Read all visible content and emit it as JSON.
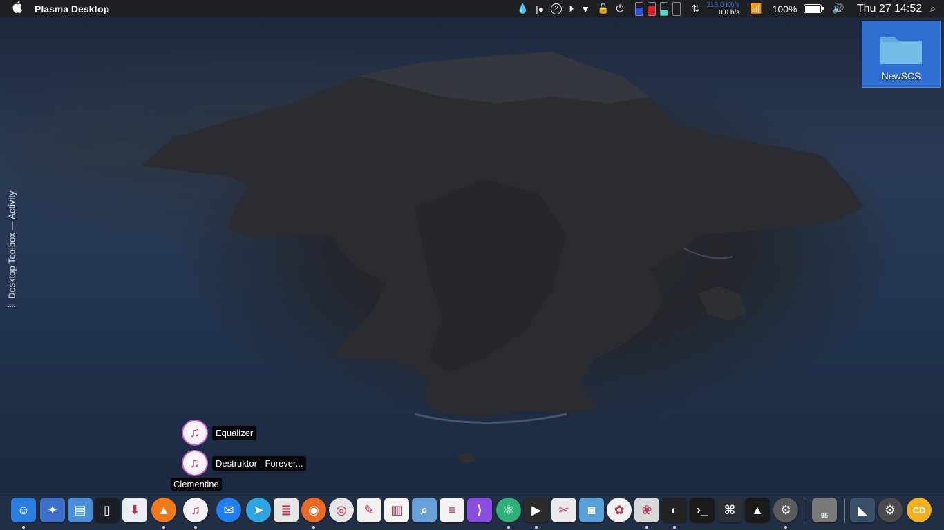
{
  "menubar": {
    "app_title": "Plasma Desktop",
    "tray": {
      "badge_number": "2",
      "net_up": "213.0 Kb/s",
      "net_down": "0.0 b/s",
      "battery_percent": "100%",
      "clock": "Thu 27  14:52"
    }
  },
  "desktop": {
    "folder_label": "NewSCS",
    "toolbox_label": "Desktop Toolbox — Activity"
  },
  "popup": {
    "entries": [
      {
        "label": "Equalizer"
      },
      {
        "label": "Destruktor - Forever..."
      }
    ],
    "tooltip": "Clementine"
  },
  "dock": {
    "icons": [
      {
        "name": "finder-icon",
        "color": "#2a7de1",
        "glyph": "☺"
      },
      {
        "name": "kde-icon",
        "color": "#3c6fc8",
        "glyph": "✦"
      },
      {
        "name": "files-icon",
        "color": "#4a8fd8",
        "glyph": "▤"
      },
      {
        "name": "kdeconnect-icon",
        "color": "#1b1e24",
        "glyph": "▯"
      },
      {
        "name": "qbittorrent-icon",
        "color": "#e8eef4",
        "glyph": "⬇"
      },
      {
        "name": "vlc-icon",
        "color": "#f07a1a",
        "glyph": "▲"
      },
      {
        "name": "clementine-icon",
        "color": "#f5f0f6",
        "glyph": "♫"
      },
      {
        "name": "messenger-icon",
        "color": "#1f7ff0",
        "glyph": "✉"
      },
      {
        "name": "telegram-icon",
        "color": "#2ca5e0",
        "glyph": "➤"
      },
      {
        "name": "news-icon",
        "color": "#e6e6e6",
        "glyph": "≣"
      },
      {
        "name": "firefox-icon",
        "color": "#e86a23",
        "glyph": "◉"
      },
      {
        "name": "chrome-icon",
        "color": "#e6e6e6",
        "glyph": "◎"
      },
      {
        "name": "text-editor-icon",
        "color": "#f0f0f0",
        "glyph": "✎"
      },
      {
        "name": "charts-icon",
        "color": "#f4f4f4",
        "glyph": "▥"
      },
      {
        "name": "image-viewer-icon",
        "color": "#6aa0d8",
        "glyph": "⌕"
      },
      {
        "name": "document-icon",
        "color": "#f2f2f2",
        "glyph": "≡"
      },
      {
        "name": "vscode-icon",
        "color": "#8a4fe0",
        "glyph": "⟩"
      },
      {
        "name": "atom-icon",
        "color": "#2fb07a",
        "glyph": "⚛"
      },
      {
        "name": "video-editor-icon",
        "color": "#2a2a2a",
        "glyph": "▶"
      },
      {
        "name": "paint-icon",
        "color": "#eaeaea",
        "glyph": "✂"
      },
      {
        "name": "screenshot-icon",
        "color": "#5aa0d8",
        "glyph": "◙"
      },
      {
        "name": "photos-app-icon",
        "color": "#f2f2f2",
        "glyph": "✿"
      },
      {
        "name": "photos-icon",
        "color": "#d8d8d8",
        "glyph": "❀"
      },
      {
        "name": "photoscape-icon",
        "color": "#222222",
        "glyph": "◐"
      },
      {
        "name": "terminal-icon",
        "color": "#1a1a1a",
        "glyph": "›_"
      },
      {
        "name": "network-icon",
        "color": "#2b2f36",
        "glyph": "⌘"
      },
      {
        "name": "system-monitor-icon",
        "color": "#1a1a1a",
        "glyph": "▲"
      },
      {
        "name": "system-settings-icon",
        "color": "#5a5a5a",
        "glyph": "⚙"
      },
      {
        "name": "trash-icon",
        "color": "#7a7a7a",
        "glyph": "🗑"
      },
      {
        "name": "plasma-icon",
        "color": "#3a5068",
        "glyph": "◣"
      },
      {
        "name": "settings-icon",
        "color": "#4a4a4a",
        "glyph": "⚙"
      },
      {
        "name": "cd-icon",
        "color": "#f0b020",
        "glyph": "CD"
      }
    ],
    "trash_count": "95"
  }
}
